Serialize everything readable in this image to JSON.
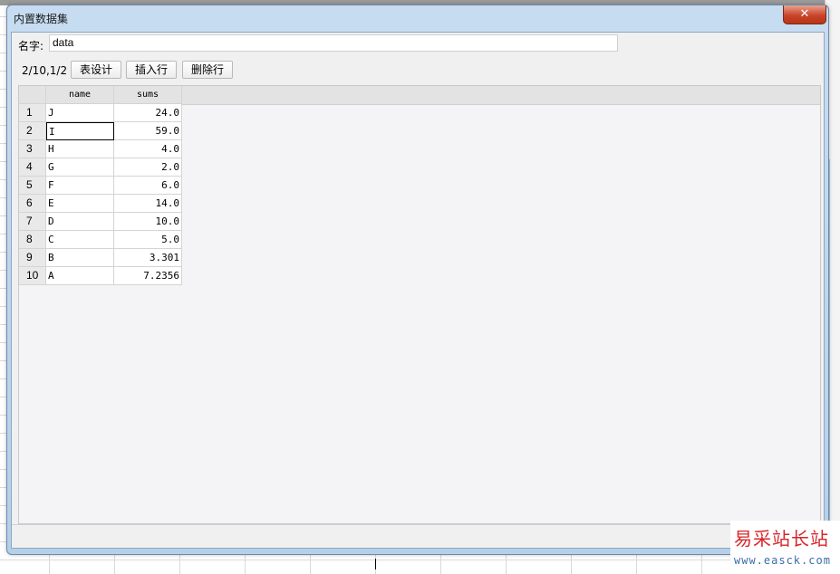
{
  "dialog": {
    "title": "内置数据集",
    "close_label": "✕",
    "name_label": "名字:",
    "name_value": "data",
    "pager": "2/10,1/2",
    "buttons": {
      "design": "表设计",
      "insert_row": "插入行",
      "delete_row": "删除行"
    }
  },
  "table": {
    "columns": [
      "name",
      "sums"
    ],
    "rows": [
      {
        "num": "1",
        "name": "J",
        "sums": "24.0"
      },
      {
        "num": "2",
        "name": "I",
        "sums": "59.0"
      },
      {
        "num": "3",
        "name": "H",
        "sums": "4.0"
      },
      {
        "num": "4",
        "name": "G",
        "sums": "2.0"
      },
      {
        "num": "5",
        "name": "F",
        "sums": "6.0"
      },
      {
        "num": "6",
        "name": "E",
        "sums": "14.0"
      },
      {
        "num": "7",
        "name": "D",
        "sums": "10.0"
      },
      {
        "num": "8",
        "name": "C",
        "sums": "5.0"
      },
      {
        "num": "9",
        "name": "B",
        "sums": "3.301"
      },
      {
        "num": "10",
        "name": "A",
        "sums": "7.2356"
      }
    ],
    "active_row": 2
  },
  "watermark": {
    "cn": "易采站长站",
    "en": "www.easck.com"
  }
}
